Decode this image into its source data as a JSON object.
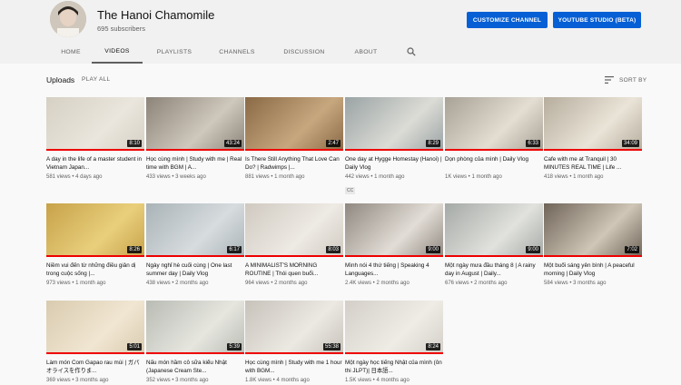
{
  "channel": {
    "name": "The Hanoi Chamomile",
    "subscribers": "695 subscribers",
    "customize_label": "CUSTOMIZE CHANNEL",
    "studio_label": "YOUTUBE STUDIO (BETA)"
  },
  "tabs": [
    "HOME",
    "VIDEOS",
    "PLAYLISTS",
    "CHANNELS",
    "DISCUSSION",
    "ABOUT"
  ],
  "active_tab": "VIDEOS",
  "uploads": {
    "title": "Uploads",
    "play_all": "PLAY ALL",
    "sort_by": "SORT BY"
  },
  "videos": [
    {
      "title": "A day in the life of a master student in Vietnam Japan...",
      "meta": "581 views • 4 days ago",
      "duration": "8:10",
      "watched": 1.0,
      "colors": [
        "#d6d0c4",
        "#eae6dd"
      ]
    },
    {
      "title": "Học cùng mình | Study with me | Real time with BGM | A...",
      "meta": "433 views • 3 weeks ago",
      "duration": "43:24",
      "watched": 1.0,
      "colors": [
        "#8c8479",
        "#cfc8bd"
      ]
    },
    {
      "title": "Is There Still Anything That Love Can Do? | Radwimps |...",
      "meta": "881 views • 1 month ago",
      "duration": "2:47",
      "watched": 1.0,
      "colors": [
        "#8a6a46",
        "#c7a77e"
      ]
    },
    {
      "title": "One day at Hygge Homestay (Hanoi) | Daily Vlog",
      "meta": "442 views • 1 month ago",
      "duration": "8:29",
      "watched": 1.0,
      "badge": "CC",
      "colors": [
        "#9aa3a4",
        "#dcdcd6"
      ]
    },
    {
      "title": "Dọn phòng của mình | Daily Vlog",
      "meta": "1K views • 1 month ago",
      "duration": "6:33",
      "watched": 1.0,
      "colors": [
        "#a7a196",
        "#e3ddd2"
      ]
    },
    {
      "title": "Cafe with me at Tranquil | 30 MINUTES REAL TIME | Life ...",
      "meta": "418 views • 1 month ago",
      "duration": "34:09",
      "watched": 1.0,
      "colors": [
        "#b6ad9d",
        "#eae4d8"
      ]
    },
    {
      "title": "Niềm vui đến từ những điều giản dị trong cuộc sống |...",
      "meta": "973 views • 1 month ago",
      "duration": "8:26",
      "watched": 1.0,
      "colors": [
        "#c7a24a",
        "#e9cf7c"
      ]
    },
    {
      "title": "Ngày nghỉ hè cuối cùng | One last summer day | Daily Vlog",
      "meta": "438 views • 2 months ago",
      "duration": "6:17",
      "watched": 1.0,
      "colors": [
        "#a9b3b7",
        "#d7dcde"
      ]
    },
    {
      "title": "A MINIMALIST'S MORNING ROUTINE | Thói quen buổi...",
      "meta": "964 views • 2 months ago",
      "duration": "8:03",
      "watched": 1.0,
      "colors": [
        "#cfc9c0",
        "#eeeae4"
      ]
    },
    {
      "title": "Mình nói 4 thứ tiếng | Speaking 4 Languages...",
      "meta": "2.4K views • 2 months ago",
      "duration": "9:00",
      "watched": 1.0,
      "colors": [
        "#8f8880",
        "#e2ddd6"
      ]
    },
    {
      "title": "Một ngày mưa đầu tháng 8 | A rainy day in August | Daily...",
      "meta": "676 views • 2 months ago",
      "duration": "9:00",
      "watched": 1.0,
      "colors": [
        "#a5a9a5",
        "#e1e2de"
      ]
    },
    {
      "title": "Một buổi sáng yên bình | A peaceful morning | Daily Vlog",
      "meta": "584 views • 3 months ago",
      "duration": "7:02",
      "watched": 1.0,
      "colors": [
        "#6f6458",
        "#cfc6b7"
      ]
    },
    {
      "title": "Làm món Com Gapao rau mùi | ガパオライスを作りま...",
      "meta": "369 views • 3 months ago",
      "duration": "5:01",
      "watched": 1.0,
      "colors": [
        "#d9cbb0",
        "#f1e6d2"
      ]
    },
    {
      "title": "Nấu món hầm cô sữa kiểu Nhật (Japanese Cream Ste...",
      "meta": "352 views • 3 months ago",
      "duration": "5:39",
      "watched": 1.0,
      "colors": [
        "#b9bcb4",
        "#e6e6df"
      ]
    },
    {
      "title": "Học cùng mình | Study with me 1 hour with BGM...",
      "meta": "1.8K views • 4 months ago",
      "duration": "55:38",
      "watched": 1.0,
      "colors": [
        "#c7c2ba",
        "#ece9e3"
      ]
    },
    {
      "title": "Một ngày học tiếng Nhật của mình (ôn thi JLPT)| 日本語...",
      "meta": "1.5K views • 4 months ago",
      "duration": "8:24",
      "watched": 1.0,
      "colors": [
        "#d3cfc8",
        "#efece6"
      ]
    }
  ]
}
